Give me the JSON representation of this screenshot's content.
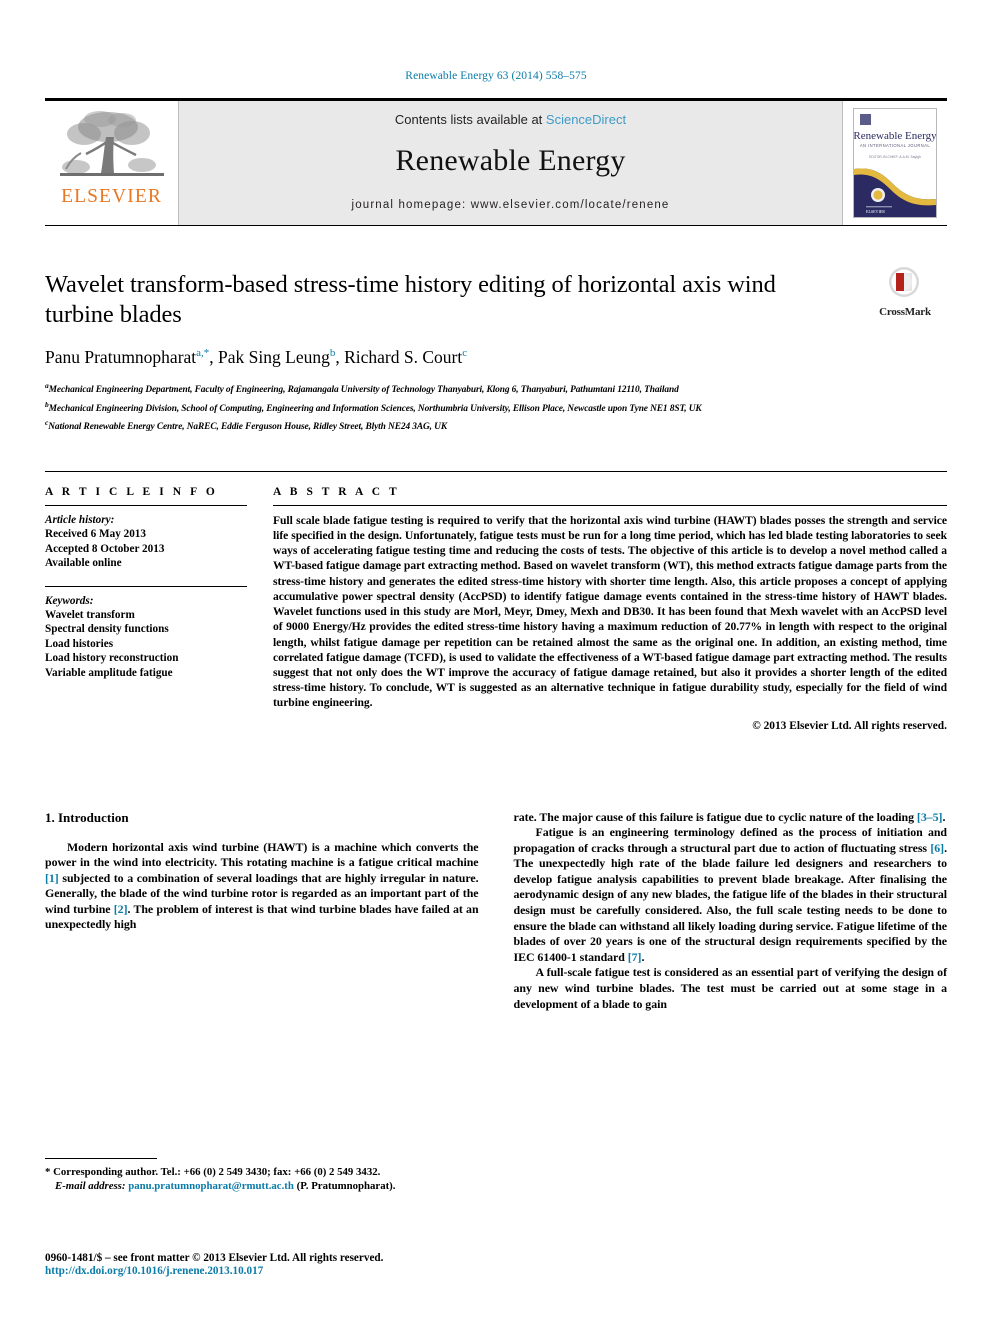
{
  "running_head": "Renewable Energy 63 (2014) 558–575",
  "masthead": {
    "publisher_name": "ELSEVIER",
    "contents_prefix": "Contents lists available at ",
    "sciencedirect": "ScienceDirect",
    "journal_name": "Renewable Energy",
    "homepage": "journal homepage: www.elsevier.com/locate/renene",
    "cover": {
      "journal_title": "Renewable Energy",
      "subtitle": "AN INTERNATIONAL JOURNAL",
      "editor_line": "EDITOR-IN-CHIEF: A.A.M. Sayigh",
      "publisher": "ELSEVIER"
    },
    "colors": {
      "sciencedirect": "#3d9bc7",
      "elsevier_orange": "#E87722",
      "cover_navy": "#2b2a63",
      "cover_gold": "#e4b93f"
    }
  },
  "article": {
    "title": "Wavelet transform-based stress-time history editing of horizontal axis wind turbine blades",
    "crossmark_label": "CrossMark",
    "authors": [
      {
        "name": "Panu Pratumnopharat",
        "marks": "a,*"
      },
      {
        "name": "Pak Sing Leung",
        "marks": "b"
      },
      {
        "name": "Richard S. Court",
        "marks": "c"
      }
    ],
    "affiliations": [
      {
        "mark": "a",
        "text": "Mechanical Engineering Department, Faculty of Engineering, Rajamangala University of Technology Thanyaburi, Klong 6, Thanyaburi, Pathumtani 12110, Thailand"
      },
      {
        "mark": "b",
        "text": "Mechanical Engineering Division, School of Computing, Engineering and Information Sciences, Northumbria University, Ellison Place, Newcastle upon Tyne NE1 8ST, UK"
      },
      {
        "mark": "c",
        "text": "National Renewable Energy Centre, NaREC, Eddie Ferguson House, Ridley Street, Blyth NE24 3AG, UK"
      }
    ]
  },
  "article_info": {
    "heading": "A R T I C L E    I N F O",
    "history_title": "Article history:",
    "history": [
      "Received 6 May 2013",
      "Accepted 8 October 2013",
      "Available online"
    ],
    "keywords_title": "Keywords:",
    "keywords": [
      "Wavelet transform",
      "Spectral density functions",
      "Load histories",
      "Load history reconstruction",
      "Variable amplitude fatigue"
    ]
  },
  "abstract": {
    "heading": "A B S T R A C T",
    "text": "Full scale blade fatigue testing is required to verify that the horizontal axis wind turbine (HAWT) blades posses the strength and service life specified in the design. Unfortunately, fatigue tests must be run for a long time period, which has led blade testing laboratories to seek ways of accelerating fatigue testing time and reducing the costs of tests. The objective of this article is to develop a novel method called a WT-based fatigue damage part extracting method. Based on wavelet transform (WT), this method extracts fatigue damage parts from the stress-time history and generates the edited stress-time history with shorter time length. Also, this article proposes a concept of applying accumulative power spectral density (AccPSD) to identify fatigue damage events contained in the stress-time history of HAWT blades. Wavelet functions used in this study are Morl, Meyr, Dmey, Mexh and DB30. It has been found that Mexh wavelet with an AccPSD level of 9000 Energy/Hz provides the edited stress-time history having a maximum reduction of 20.77% in length with respect to the original length, whilst fatigue damage per repetition can be retained almost the same as the original one. In addition, an existing method, time correlated fatigue damage (TCFD), is used to validate the effectiveness of a WT-based fatigue damage part extracting method. The results suggest that not only does the WT improve the accuracy of fatigue damage retained, but also it provides a shorter length of the edited stress-time history. To conclude, WT is suggested as an alternative technique in fatigue durability study, especially for the field of wind turbine engineering.",
    "copyright": "© 2013 Elsevier Ltd. All rights reserved."
  },
  "body": {
    "section_heading": "1. Introduction",
    "left_paragraph_1_a": "Modern horizontal axis wind turbine (HAWT) is a machine which converts the power in the wind into electricity. This rotating machine is a fatigue critical machine ",
    "ref1": "[1]",
    "left_paragraph_1_b": " subjected to a combination of several loadings that are highly irregular in nature. Generally, the blade of the wind turbine rotor is regarded as an important part of the wind turbine ",
    "ref2": "[2]",
    "left_paragraph_1_c": ". The problem of interest is that wind turbine blades have failed at an unexpectedly high",
    "right_continuation_a": "rate. The major cause of this failure is fatigue due to cyclic nature of the loading ",
    "ref35": "[3–5]",
    "right_continuation_b": ".",
    "right_paragraph_2_a": "Fatigue is an engineering terminology defined as the process of initiation and propagation of cracks through a structural part due to action of fluctuating stress ",
    "ref6": "[6]",
    "right_paragraph_2_b": ". The unexpectedly high rate of the blade failure led designers and researchers to develop fatigue analysis capabilities to prevent blade breakage. After finalising the aerodynamic design of any new blades, the fatigue life of the blades in their structural design must be carefully considered. Also, the full scale testing needs to be done to ensure the blade can withstand all likely loading during service. Fatigue lifetime of the blades of over 20 years is one of the structural design requirements specified by the IEC 61400-1 standard ",
    "ref7": "[7]",
    "right_paragraph_2_c": ".",
    "right_paragraph_3": "A full-scale fatigue test is considered as an essential part of verifying the design of any new wind turbine blades. The test must be carried out at some stage in a development of a blade to gain"
  },
  "footnote": {
    "corresponding": "* Corresponding author. Tel.: +66 (0) 2 549 3430; fax: +66 (0) 2 549 3432.",
    "email_label": "E-mail address:",
    "email": "panu.pratumnopharat@rmutt.ac.th",
    "email_owner": "(P. Pratumnopharat)."
  },
  "footer": {
    "issn_line": "0960-1481/$ – see front matter © 2013 Elsevier Ltd. All rights reserved.",
    "doi": "http://dx.doi.org/10.1016/j.renene.2013.10.017"
  }
}
